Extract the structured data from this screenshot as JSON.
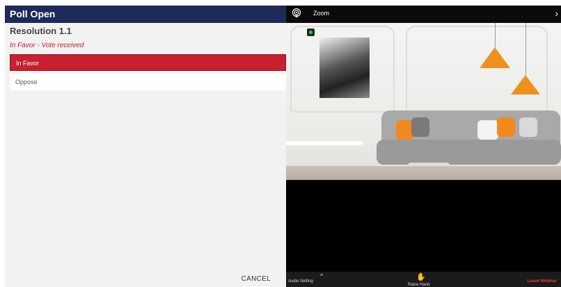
{
  "poll": {
    "header_title": "Poll Open",
    "resolution_title": "Resolution 1.1",
    "vote_status": "In Favor - Vote received",
    "options": [
      {
        "label": "In Favor",
        "selected": true
      },
      {
        "label": "Oppose",
        "selected": false
      }
    ],
    "cancel_label": "CANCEL"
  },
  "zoom": {
    "title": "Zoom",
    "icons": {
      "broadcast": "broadcast-icon",
      "chevron": "chevron-right-icon",
      "hand": "raise-hand-icon",
      "caret": "caret-up-icon",
      "status": "video-status-icon"
    },
    "bottom_bar": {
      "audio_label": "Audio Setting",
      "raise_hand_label": "Raise Hand",
      "leave_label": "Leave Webinar"
    }
  },
  "colors": {
    "header_bg": "#1e2a57",
    "accent_red": "#c8202f",
    "lamp_orange": "#f0901c",
    "leave_red": "#e4413b"
  }
}
